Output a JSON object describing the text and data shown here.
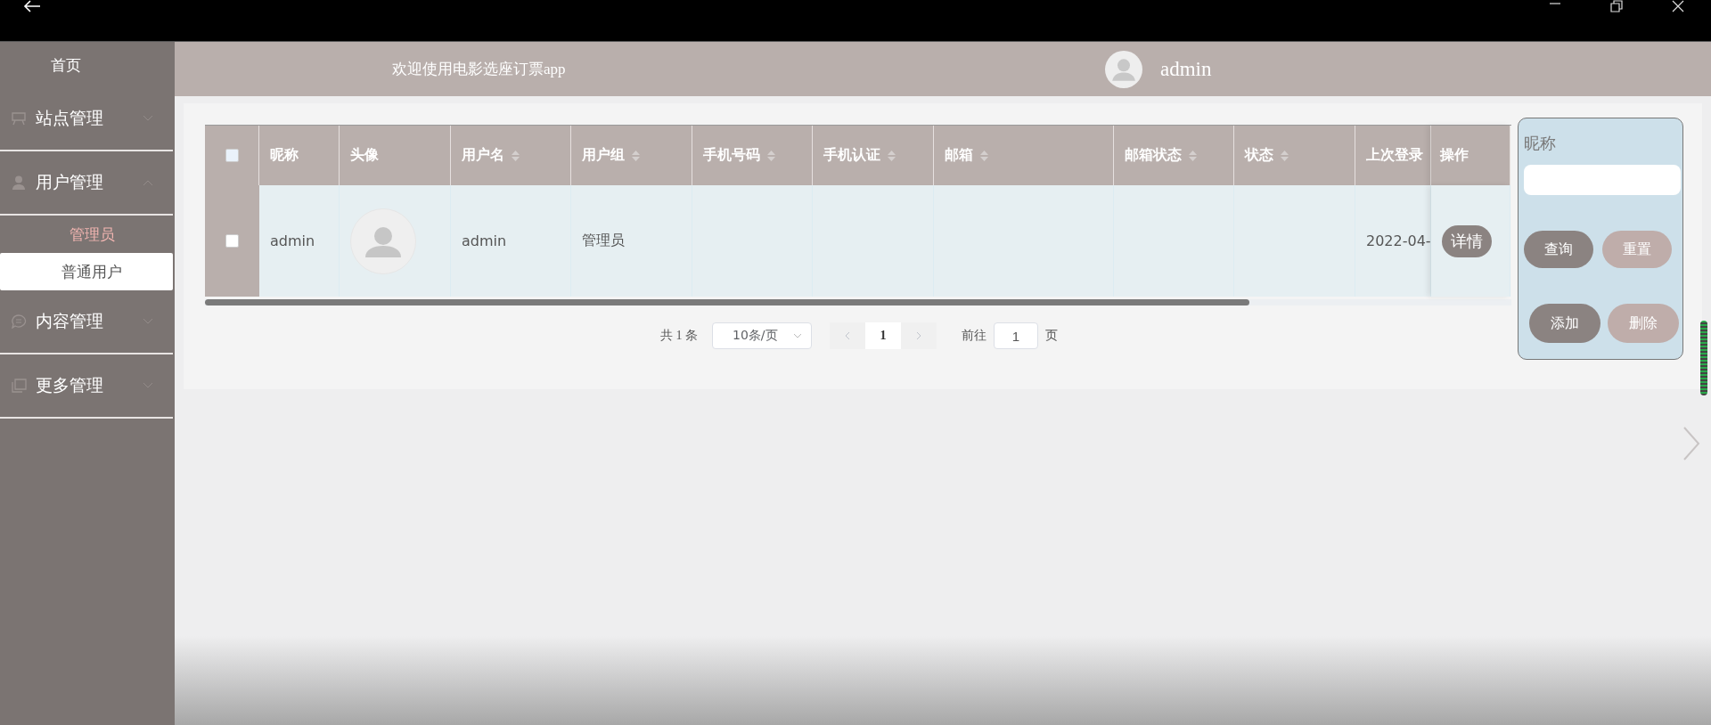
{
  "sidebar": {
    "items": [
      {
        "label": "首页",
        "kind": "home"
      },
      {
        "label": "站点管理",
        "kind": "station",
        "expanded": false
      },
      {
        "label": "用户管理",
        "kind": "user",
        "expanded": true,
        "children": [
          {
            "label": "管理员",
            "selected": true,
            "hovered": false
          },
          {
            "label": "普通用户",
            "selected": false,
            "hovered": true
          }
        ]
      },
      {
        "label": "内容管理",
        "kind": "chat",
        "expanded": false
      },
      {
        "label": "更多管理",
        "kind": "copy",
        "expanded": false
      }
    ]
  },
  "header": {
    "welcome": "欢迎使用电影选座订票app",
    "user": "admin"
  },
  "table": {
    "select_all": {
      "checked": false
    },
    "columns": [
      {
        "label": "昵称",
        "sortable": false
      },
      {
        "label": "头像",
        "sortable": false
      },
      {
        "label": "用户名",
        "sortable": true
      },
      {
        "label": "用户组",
        "sortable": true
      },
      {
        "label": "手机号码",
        "sortable": true
      },
      {
        "label": "手机认证",
        "sortable": true
      },
      {
        "label": "邮箱",
        "sortable": true
      },
      {
        "label": "邮箱状态",
        "sortable": true
      },
      {
        "label": "状态",
        "sortable": true
      },
      {
        "label": "上次登录"
      },
      {
        "label": "操作",
        "sortable": false
      }
    ],
    "rows": [
      {
        "checked": false,
        "cells": [
          {
            "kind": "text",
            "text": "admin"
          },
          {
            "kind": "avatar"
          },
          {
            "kind": "text",
            "text": "admin"
          },
          {
            "kind": "text",
            "text": "管理员"
          },
          {
            "kind": "blank"
          },
          {
            "kind": "blank"
          },
          {
            "kind": "blank"
          },
          {
            "kind": "blank"
          },
          {
            "kind": "blank"
          },
          {
            "kind": "text",
            "text": "2022-04-"
          },
          {
            "kind": "button",
            "text": "详情"
          }
        ]
      }
    ]
  },
  "pagination": {
    "total": "共 1 条",
    "page_size": "10条/页",
    "pages": [
      {
        "label": "1",
        "selected": true
      }
    ],
    "goto_label": "前往",
    "goto_value": "1",
    "goto_suffix": "页"
  },
  "search_panel": {
    "label": "昵称",
    "buttons": [
      {
        "label": "查询",
        "kind": "primary"
      },
      {
        "label": "重置",
        "kind": "secondary"
      },
      {
        "label": "添加",
        "kind": "primary"
      },
      {
        "label": "删除",
        "kind": "secondary"
      }
    ]
  }
}
